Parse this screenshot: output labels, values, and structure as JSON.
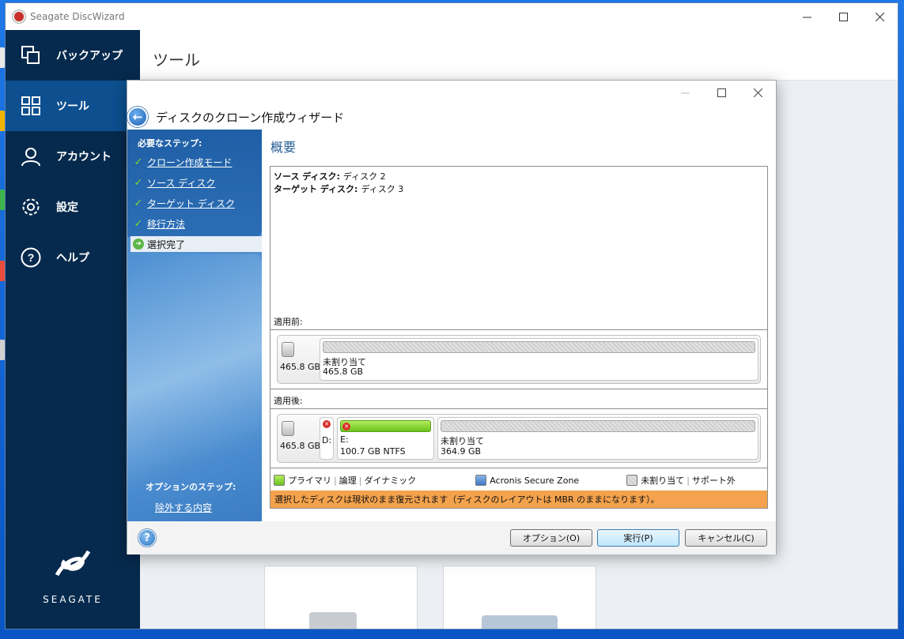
{
  "app": {
    "title": "Seagate DiscWizard"
  },
  "nav": {
    "items": [
      {
        "label": "バックアップ",
        "icon": "backup-icon"
      },
      {
        "label": "ツール",
        "icon": "tools-grid-icon"
      },
      {
        "label": "アカウント",
        "icon": "account-icon"
      },
      {
        "label": "設定",
        "icon": "gear-icon"
      },
      {
        "label": "ヘルプ",
        "icon": "help-icon"
      }
    ],
    "brand": "SEAGATE"
  },
  "content": {
    "heading": "ツール"
  },
  "wizard": {
    "title": "ディスクのクローン作成ウィザード",
    "steps_title": "必要なステップ:",
    "steps": [
      {
        "label": "クローン作成モード",
        "done": true
      },
      {
        "label": "ソース ディスク",
        "done": true
      },
      {
        "label": "ターゲット ディスク",
        "done": true
      },
      {
        "label": "移行方法",
        "done": true
      },
      {
        "label": "選択完了",
        "current": true
      }
    ],
    "optional_title": "オプションのステップ:",
    "optional_link": "除外する内容",
    "summary_heading": "概要",
    "source_label": "ソース ディスク:",
    "source_value": "ディスク 2",
    "target_label": "ターゲット ディスク:",
    "target_value": "ディスク 3",
    "before_label": "適用前:",
    "after_label": "適用後:",
    "before": {
      "disk_size": "465.8 GB",
      "partitions": [
        {
          "name": "未割り当て",
          "size": "465.8 GB"
        }
      ]
    },
    "after": {
      "disk_size": "465.8 GB",
      "partitions": [
        {
          "name": "D:"
        },
        {
          "name": "E:",
          "size": "100.7 GB  NTFS"
        },
        {
          "name": "未割り当て",
          "size": "364.9 GB"
        }
      ]
    },
    "legend": {
      "primary": "プライマリ",
      "logical": "論理",
      "dynamic": "ダイナミック",
      "acronis": "Acronis Secure Zone",
      "unallocated": "未割り当て",
      "unsupported": "サポート外"
    },
    "warning": "選択したディスクは現状のまま復元されます（ディスクのレイアウトは MBR のままになります）。",
    "buttons": {
      "options": "オプション(O)",
      "run": "実行(P)",
      "cancel": "キャンセル(C)"
    }
  },
  "colors": {
    "nav_bg": "#062a4d",
    "nav_active": "#0d4f8f",
    "warning_bg": "#f4a24d",
    "accent": "#285d97"
  }
}
